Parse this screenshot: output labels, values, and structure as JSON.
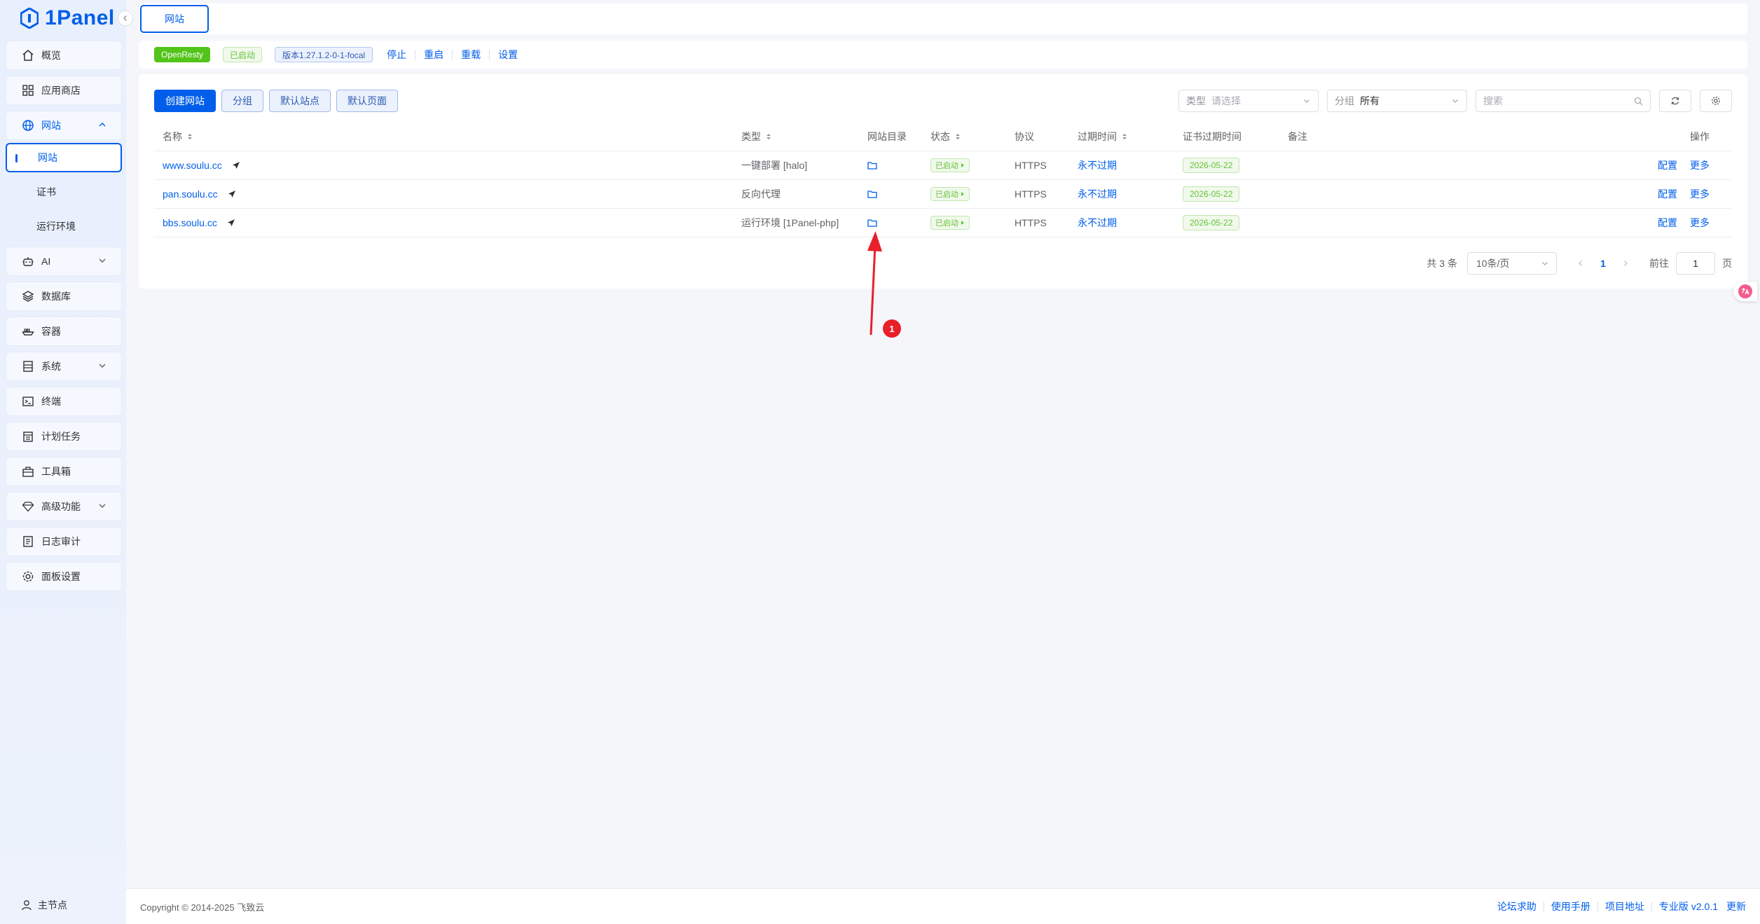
{
  "app": {
    "name": "1Panel"
  },
  "sidebar": {
    "items": [
      {
        "label": "概览",
        "icon": "home-icon"
      },
      {
        "label": "应用商店",
        "icon": "grid-icon"
      },
      {
        "label": "网站",
        "icon": "globe-icon",
        "expanded": true,
        "children": [
          {
            "label": "网站",
            "active": true
          },
          {
            "label": "证书"
          },
          {
            "label": "运行环境"
          }
        ]
      },
      {
        "label": "AI",
        "icon": "robot-icon",
        "has_children": true
      },
      {
        "label": "数据库",
        "icon": "layers-icon"
      },
      {
        "label": "容器",
        "icon": "ship-icon"
      },
      {
        "label": "系统",
        "icon": "server-icon",
        "has_children": true
      },
      {
        "label": "终端",
        "icon": "terminal-icon"
      },
      {
        "label": "计划任务",
        "icon": "calendar-icon"
      },
      {
        "label": "工具箱",
        "icon": "toolbox-icon"
      },
      {
        "label": "高级功能",
        "icon": "diamond-icon",
        "has_children": true
      },
      {
        "label": "日志审计",
        "icon": "log-icon"
      },
      {
        "label": "面板设置",
        "icon": "gear-icon"
      }
    ],
    "footer_label": "主节点"
  },
  "tabs": {
    "active": "网站"
  },
  "status": {
    "app_name": "OpenResty",
    "state": "已启动",
    "version": "版本1.27.1.2-0-1-focal",
    "actions": [
      "停止",
      "重启",
      "重载",
      "设置"
    ]
  },
  "toolbar": {
    "create": "创建网站",
    "group": "分组",
    "default_site": "默认站点",
    "default_page": "默认页面"
  },
  "filters": {
    "type_label": "类型",
    "type_placeholder": "请选择",
    "group_label": "分组",
    "group_value": "所有",
    "search_placeholder": "搜索"
  },
  "table": {
    "headers": {
      "name": "名称",
      "type": "类型",
      "dir": "网站目录",
      "state": "状态",
      "protocol": "协议",
      "expire": "过期时间",
      "cert_expire": "证书过期时间",
      "note": "备注",
      "ops": "操作"
    },
    "rows": [
      {
        "name": "www.soulu.cc",
        "type": "一键部署 [halo]",
        "state": "已启动",
        "protocol": "HTTPS",
        "expire": "永不过期",
        "cert_expire": "2026-05-22",
        "op_config": "配置",
        "op_more": "更多"
      },
      {
        "name": "pan.soulu.cc",
        "type": "反向代理",
        "state": "已启动",
        "protocol": "HTTPS",
        "expire": "永不过期",
        "cert_expire": "2026-05-22",
        "op_config": "配置",
        "op_more": "更多"
      },
      {
        "name": "bbs.soulu.cc",
        "type": "运行环境 [1Panel-php]",
        "state": "已启动",
        "protocol": "HTTPS",
        "expire": "永不过期",
        "cert_expire": "2026-05-22",
        "op_config": "配置",
        "op_more": "更多"
      }
    ]
  },
  "pagination": {
    "total": "共 3 条",
    "page_size": "10条/页",
    "current": "1",
    "goto_label": "前往",
    "goto_value": "1",
    "page_unit": "页"
  },
  "annotation": {
    "number": "1",
    "color": "#e8202a"
  },
  "footer": {
    "copyright": "Copyright © 2014-2025 飞致云",
    "links": [
      "论坛求助",
      "使用手册",
      "项目地址"
    ],
    "edition": "专业版",
    "version": "v2.0.1",
    "update": "更新"
  },
  "colors": {
    "primary": "#005eeb",
    "success": "#67c23a"
  }
}
